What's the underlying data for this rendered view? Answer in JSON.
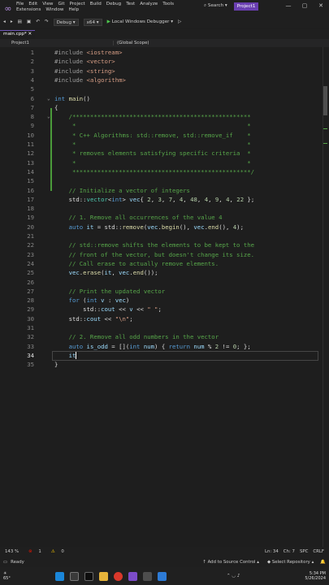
{
  "menu": {
    "row1": [
      "File",
      "Edit",
      "View",
      "Git",
      "Project",
      "Build",
      "Debug",
      "Test",
      "Analyze",
      "Tools"
    ],
    "row2": [
      "Extensions",
      "Window",
      "Help"
    ],
    "search": "Search",
    "project": "Project1"
  },
  "toolbar": {
    "config": "Debug",
    "platform": "x64",
    "run_label": "Local Windows Debugger"
  },
  "tabs": {
    "active": "main.cpp*"
  },
  "nav": {
    "project": "Project1",
    "scope": "(Global Scope)"
  },
  "editor": {
    "current_line": 34,
    "lines": [
      {
        "n": "1",
        "t": [
          [
            "pp",
            "#include "
          ],
          [
            "inc",
            "<iostream>"
          ]
        ]
      },
      {
        "n": "2",
        "t": [
          [
            "pp",
            "#include "
          ],
          [
            "inc",
            "<vector>"
          ]
        ]
      },
      {
        "n": "3",
        "t": [
          [
            "pp",
            "#include "
          ],
          [
            "inc",
            "<string>"
          ]
        ]
      },
      {
        "n": "4",
        "t": [
          [
            "pp",
            "#include "
          ],
          [
            "inc",
            "<algorithm>"
          ]
        ]
      },
      {
        "n": "5",
        "t": []
      },
      {
        "n": "6",
        "t": [
          [
            "kw",
            "int "
          ],
          [
            "fn",
            "main"
          ],
          [
            "txt",
            "()"
          ]
        ]
      },
      {
        "n": "7",
        "t": [
          [
            "txt",
            "{"
          ]
        ]
      },
      {
        "n": "8",
        "t": [
          [
            "cm",
            "    /**************************************************"
          ]
        ]
      },
      {
        "n": "9",
        "t": [
          [
            "cm",
            "     *                                                *"
          ]
        ]
      },
      {
        "n": "10",
        "t": [
          [
            "cm",
            "     * C++ Algorithms: std::remove, std::remove_if    *"
          ]
        ]
      },
      {
        "n": "11",
        "t": [
          [
            "cm",
            "     *                                                *"
          ]
        ]
      },
      {
        "n": "12",
        "t": [
          [
            "cm",
            "     * removes elements satisfying specific criteria  *"
          ]
        ]
      },
      {
        "n": "13",
        "t": [
          [
            "cm",
            "     *                                                *"
          ]
        ]
      },
      {
        "n": "14",
        "t": [
          [
            "cm",
            "     **************************************************/"
          ]
        ]
      },
      {
        "n": "15",
        "t": []
      },
      {
        "n": "16",
        "t": [
          [
            "cm",
            "    // Initialize a vector of integers"
          ]
        ]
      },
      {
        "n": "17",
        "t": [
          [
            "txt",
            "    std::"
          ],
          [
            "ty",
            "vector"
          ],
          [
            "txt",
            "<"
          ],
          [
            "kw",
            "int"
          ],
          [
            "txt",
            "> "
          ],
          [
            "var",
            "vec"
          ],
          [
            "txt",
            "{ "
          ],
          [
            "num",
            "2"
          ],
          [
            "txt",
            ", "
          ],
          [
            "num",
            "3"
          ],
          [
            "txt",
            ", "
          ],
          [
            "num",
            "7"
          ],
          [
            "txt",
            ", "
          ],
          [
            "num",
            "4"
          ],
          [
            "txt",
            ", "
          ],
          [
            "num",
            "48"
          ],
          [
            "txt",
            ", "
          ],
          [
            "num",
            "4"
          ],
          [
            "txt",
            ", "
          ],
          [
            "num",
            "9"
          ],
          [
            "txt",
            ", "
          ],
          [
            "num",
            "4"
          ],
          [
            "txt",
            ", "
          ],
          [
            "num",
            "22"
          ],
          [
            "txt",
            " };"
          ]
        ]
      },
      {
        "n": "18",
        "t": []
      },
      {
        "n": "19",
        "t": [
          [
            "cm",
            "    // 1. Remove all occurrences of the value 4"
          ]
        ]
      },
      {
        "n": "20",
        "t": [
          [
            "kw",
            "    auto "
          ],
          [
            "var",
            "it"
          ],
          [
            "txt",
            " = std::"
          ],
          [
            "fn",
            "remove"
          ],
          [
            "txt",
            "("
          ],
          [
            "var",
            "vec"
          ],
          [
            "txt",
            "."
          ],
          [
            "fn",
            "begin"
          ],
          [
            "txt",
            "(), "
          ],
          [
            "var",
            "vec"
          ],
          [
            "txt",
            "."
          ],
          [
            "fn",
            "end"
          ],
          [
            "txt",
            "(), "
          ],
          [
            "num",
            "4"
          ],
          [
            "txt",
            ");"
          ]
        ]
      },
      {
        "n": "21",
        "t": []
      },
      {
        "n": "22",
        "t": [
          [
            "cm",
            "    // std::remove shifts the elements to be kept to the"
          ]
        ]
      },
      {
        "n": "23",
        "t": [
          [
            "cm",
            "    // front of the vector, but doesn't change its size."
          ]
        ]
      },
      {
        "n": "24",
        "t": [
          [
            "cm",
            "    // Call erase to actually remove elements."
          ]
        ]
      },
      {
        "n": "25",
        "t": [
          [
            "var",
            "    vec"
          ],
          [
            "txt",
            "."
          ],
          [
            "fn",
            "erase"
          ],
          [
            "txt",
            "("
          ],
          [
            "var",
            "it"
          ],
          [
            "txt",
            ", "
          ],
          [
            "var",
            "vec"
          ],
          [
            "txt",
            "."
          ],
          [
            "fn",
            "end"
          ],
          [
            "txt",
            "());"
          ]
        ]
      },
      {
        "n": "26",
        "t": []
      },
      {
        "n": "27",
        "t": [
          [
            "cm",
            "    // Print the updated vector"
          ]
        ]
      },
      {
        "n": "28",
        "t": [
          [
            "kw",
            "    for "
          ],
          [
            "txt",
            "("
          ],
          [
            "kw",
            "int "
          ],
          [
            "var",
            "v"
          ],
          [
            "txt",
            " : "
          ],
          [
            "var",
            "vec"
          ],
          [
            "txt",
            ")"
          ]
        ]
      },
      {
        "n": "29",
        "t": [
          [
            "txt",
            "        std::"
          ],
          [
            "var",
            "cout"
          ],
          [
            "txt",
            " << "
          ],
          [
            "var",
            "v"
          ],
          [
            "txt",
            " << "
          ],
          [
            "str",
            "\" \""
          ],
          [
            "txt",
            ";"
          ]
        ]
      },
      {
        "n": "30",
        "t": [
          [
            "txt",
            "    std::"
          ],
          [
            "var",
            "cout"
          ],
          [
            "txt",
            " << "
          ],
          [
            "str",
            "\"\\n\""
          ],
          [
            "txt",
            ";"
          ]
        ]
      },
      {
        "n": "31",
        "t": []
      },
      {
        "n": "32",
        "t": [
          [
            "cm",
            "    // 2. Remove all odd numbers in the vector"
          ]
        ]
      },
      {
        "n": "33",
        "t": [
          [
            "kw",
            "    auto "
          ],
          [
            "var",
            "is_odd"
          ],
          [
            "txt",
            " = []("
          ],
          [
            "kw",
            "int "
          ],
          [
            "var",
            "num"
          ],
          [
            "txt",
            ") { "
          ],
          [
            "kw",
            "return "
          ],
          [
            "var",
            "num"
          ],
          [
            "txt",
            " % "
          ],
          [
            "num",
            "2"
          ],
          [
            "txt",
            " != "
          ],
          [
            "num",
            "0"
          ],
          [
            "txt",
            "; };"
          ]
        ]
      },
      {
        "n": "34",
        "t": [
          [
            "var",
            "    it"
          ]
        ]
      },
      {
        "n": "35",
        "t": [
          [
            "txt",
            "}"
          ]
        ]
      }
    ]
  },
  "status": {
    "zoom": "143 %",
    "errors": "1",
    "warnings": "0",
    "line": "Ln: 34",
    "col": "Ch: 7",
    "spc": "SPC",
    "crlf": "CRLF"
  },
  "bottom": {
    "ready": "Ready",
    "source_control": "Add to Source Control",
    "repo": "Select Repository"
  },
  "taskbar": {
    "temp": "65°",
    "time": "5:34 PM",
    "date": "5/26/2024"
  }
}
